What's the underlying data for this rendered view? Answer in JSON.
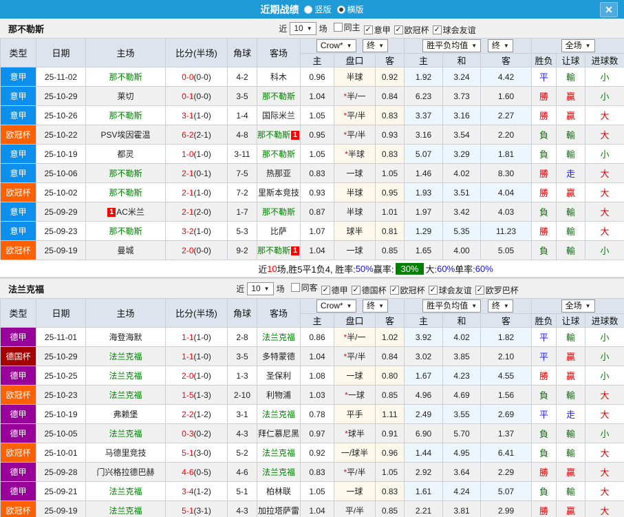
{
  "titlebar": {
    "title": "近期战绩",
    "layout_options": [
      {
        "label": "竖版",
        "selected": false
      },
      {
        "label": "横版",
        "selected": true
      }
    ],
    "close_icon": "✕"
  },
  "ui": {
    "arrow_icon": "▼",
    "check_icon": "✓"
  },
  "headers": {
    "left": [
      "类型",
      "日期",
      "主场",
      "比分(半场)",
      "角球",
      "客场"
    ],
    "sub": [
      "主",
      "盘口",
      "客",
      "主",
      "和",
      "客"
    ],
    "right": [
      "胜负",
      "让球",
      "进球数"
    ],
    "selects": {
      "company": "Crow*",
      "final1": "终",
      "avg": "胜平负均值",
      "final2": "终",
      "scope": "全场"
    }
  },
  "colors": {
    "titlebar_bg": "#1e9ad6",
    "close_bg": "#4dabdf",
    "header_bg": "#dee4ee",
    "filter_bg": "#f0f0f0",
    "row_alt_bg": "#f0f0f0",
    "handicap_bg": "#fdf8ec",
    "avg_bg": "#edf6fc",
    "team_green": "#008000",
    "score_red": "#ff0000",
    "win_red": "#dd0000",
    "lose_green": "#008000",
    "draw_blue": "#2222ee",
    "summary_blue": "#1111ee",
    "summary_green_bg": "#008000",
    "border": "#c9cfd7"
  },
  "comp_colors": {
    "意甲": "#0d8fee",
    "欧冠杯": "#ff6000",
    "德甲": "#990099",
    "德国杯": "#a40000"
  },
  "sections": [
    {
      "team": "那不勒斯",
      "filter": {
        "prefix": "近",
        "count": "10",
        "suffix": "场",
        "checkboxes": [
          {
            "label": "同主",
            "checked": false
          },
          {
            "label": "意甲",
            "checked": true
          },
          {
            "label": "欧冠杯",
            "checked": true
          },
          {
            "label": "球会友谊",
            "checked": true
          }
        ]
      },
      "rows": [
        {
          "comp": "意甲",
          "date": "25-11-02",
          "home": {
            "n": "那不勒斯",
            "g": 1
          },
          "score": "0-0",
          "half": "0-0",
          "corner": "4-2",
          "away": {
            "n": "科木"
          },
          "o": [
            "0.96",
            "半球",
            "0.92"
          ],
          "avg": [
            "1.92",
            "3.24",
            "4.42"
          ],
          "res": [
            "平",
            "輸",
            "小"
          ]
        },
        {
          "comp": "意甲",
          "date": "25-10-29",
          "home": {
            "n": "莱切"
          },
          "score": "0-1",
          "half": "0-0",
          "corner": "3-5",
          "away": {
            "n": "那不勒斯",
            "g": 1
          },
          "o": [
            "1.04",
            "*半/一",
            "0.84"
          ],
          "avg": [
            "6.23",
            "3.73",
            "1.60"
          ],
          "res": [
            "勝",
            "贏",
            "小"
          ]
        },
        {
          "comp": "意甲",
          "date": "25-10-26",
          "home": {
            "n": "那不勒斯",
            "g": 1
          },
          "score": "3-1",
          "half": "1-0",
          "corner": "1-4",
          "away": {
            "n": "国际米兰"
          },
          "o": [
            "1.05",
            "*平/半",
            "0.83"
          ],
          "avg": [
            "3.37",
            "3.16",
            "2.27"
          ],
          "res": [
            "勝",
            "贏",
            "大"
          ]
        },
        {
          "comp": "欧冠杯",
          "date": "25-10-22",
          "home": {
            "n": "PSV埃因霍温"
          },
          "score": "6-2",
          "half": "2-1",
          "corner": "4-8",
          "away": {
            "n": "那不勒斯",
            "g": 1,
            "b": "1",
            "bp": "post"
          },
          "o": [
            "0.95",
            "*平/半",
            "0.93"
          ],
          "avg": [
            "3.16",
            "3.54",
            "2.20"
          ],
          "res": [
            "負",
            "輸",
            "大"
          ]
        },
        {
          "comp": "意甲",
          "date": "25-10-19",
          "home": {
            "n": "都灵"
          },
          "score": "1-0",
          "half": "1-0",
          "corner": "3-11",
          "away": {
            "n": "那不勒斯",
            "g": 1
          },
          "o": [
            "1.05",
            "*半球",
            "0.83"
          ],
          "avg": [
            "5.07",
            "3.29",
            "1.81"
          ],
          "res": [
            "負",
            "輸",
            "小"
          ]
        },
        {
          "comp": "意甲",
          "date": "25-10-06",
          "home": {
            "n": "那不勒斯",
            "g": 1
          },
          "score": "2-1",
          "half": "0-1",
          "corner": "7-5",
          "away": {
            "n": "热那亚"
          },
          "o": [
            "0.83",
            "一球",
            "1.05"
          ],
          "avg": [
            "1.46",
            "4.02",
            "8.30"
          ],
          "res": [
            "勝",
            "走",
            "大"
          ]
        },
        {
          "comp": "欧冠杯",
          "date": "25-10-02",
          "home": {
            "n": "那不勒斯",
            "g": 1
          },
          "score": "2-1",
          "half": "1-0",
          "corner": "7-2",
          "away": {
            "n": "里斯本竞技"
          },
          "o": [
            "0.93",
            "半球",
            "0.95"
          ],
          "avg": [
            "1.93",
            "3.51",
            "4.04"
          ],
          "res": [
            "勝",
            "贏",
            "大"
          ]
        },
        {
          "comp": "意甲",
          "date": "25-09-29",
          "home": {
            "n": "AC米兰",
            "b": "1",
            "bp": "pre"
          },
          "score": "2-1",
          "half": "2-0",
          "corner": "1-7",
          "away": {
            "n": "那不勒斯",
            "g": 1
          },
          "o": [
            "0.87",
            "半球",
            "1.01"
          ],
          "avg": [
            "1.97",
            "3.42",
            "4.03"
          ],
          "res": [
            "負",
            "輸",
            "大"
          ]
        },
        {
          "comp": "意甲",
          "date": "25-09-23",
          "home": {
            "n": "那不勒斯",
            "g": 1
          },
          "score": "3-2",
          "half": "1-0",
          "corner": "5-3",
          "away": {
            "n": "比萨"
          },
          "o": [
            "1.07",
            "球半",
            "0.81"
          ],
          "avg": [
            "1.29",
            "5.35",
            "11.23"
          ],
          "res": [
            "勝",
            "輸",
            "大"
          ]
        },
        {
          "comp": "欧冠杯",
          "date": "25-09-19",
          "home": {
            "n": "曼城"
          },
          "score": "2-0",
          "half": "0-0",
          "corner": "9-2",
          "away": {
            "n": "那不勒斯",
            "g": 1,
            "b": "1",
            "bp": "post"
          },
          "o": [
            "1.04",
            "一球",
            "0.85"
          ],
          "avg": [
            "1.65",
            "4.00",
            "5.05"
          ],
          "res": [
            "負",
            "輸",
            "小"
          ]
        }
      ],
      "summary": [
        {
          "t": "近"
        },
        {
          "t": "10",
          "c": "red"
        },
        {
          "t": "场,胜5平1负4, 胜率:"
        },
        {
          "t": "50%",
          "c": "blue"
        },
        {
          "t": " 赢率: "
        },
        {
          "t": "30%",
          "c": "greenbox"
        },
        {
          "t": " 大:"
        },
        {
          "t": "60%",
          "c": "blue"
        },
        {
          "t": " 单率:"
        },
        {
          "t": "60%",
          "c": "blue"
        }
      ]
    },
    {
      "team": "法兰克福",
      "filter": {
        "prefix": "近",
        "count": "10",
        "suffix": "场",
        "checkboxes": [
          {
            "label": "同客",
            "checked": false
          },
          {
            "label": "德甲",
            "checked": true
          },
          {
            "label": "德国杯",
            "checked": true
          },
          {
            "label": "欧冠杯",
            "checked": true
          },
          {
            "label": "球会友谊",
            "checked": true
          },
          {
            "label": "欧罗巴杯",
            "checked": true
          }
        ]
      },
      "rows": [
        {
          "comp": "德甲",
          "date": "25-11-01",
          "home": {
            "n": "海登海默"
          },
          "score": "1-1",
          "half": "1-0",
          "corner": "2-8",
          "away": {
            "n": "法兰克福",
            "g": 1
          },
          "o": [
            "0.86",
            "*半/一",
            "1.02"
          ],
          "avg": [
            "3.92",
            "4.02",
            "1.82"
          ],
          "res": [
            "平",
            "輸",
            "小"
          ]
        },
        {
          "comp": "德国杯",
          "date": "25-10-29",
          "home": {
            "n": "法兰克福",
            "g": 1
          },
          "score": "1-1",
          "half": "1-0",
          "corner": "3-5",
          "away": {
            "n": "多特蒙德"
          },
          "o": [
            "1.04",
            "*平/半",
            "0.84"
          ],
          "avg": [
            "3.02",
            "3.85",
            "2.10"
          ],
          "res": [
            "平",
            "贏",
            "小"
          ]
        },
        {
          "comp": "德甲",
          "date": "25-10-25",
          "home": {
            "n": "法兰克福",
            "g": 1
          },
          "score": "2-0",
          "half": "1-0",
          "corner": "1-3",
          "away": {
            "n": "圣保利"
          },
          "o": [
            "1.08",
            "一球",
            "0.80"
          ],
          "avg": [
            "1.67",
            "4.23",
            "4.55"
          ],
          "res": [
            "勝",
            "贏",
            "小"
          ]
        },
        {
          "comp": "欧冠杯",
          "date": "25-10-23",
          "home": {
            "n": "法兰克福",
            "g": 1
          },
          "score": "1-5",
          "half": "1-3",
          "corner": "2-10",
          "away": {
            "n": "利物浦"
          },
          "o": [
            "1.03",
            "*一球",
            "0.85"
          ],
          "avg": [
            "4.96",
            "4.69",
            "1.56"
          ],
          "res": [
            "負",
            "輸",
            "大"
          ]
        },
        {
          "comp": "德甲",
          "date": "25-10-19",
          "home": {
            "n": "弗赖堡"
          },
          "score": "2-2",
          "half": "1-2",
          "corner": "3-1",
          "away": {
            "n": "法兰克福",
            "g": 1
          },
          "o": [
            "0.78",
            "平手",
            "1.11"
          ],
          "avg": [
            "2.49",
            "3.55",
            "2.69"
          ],
          "res": [
            "平",
            "走",
            "大"
          ]
        },
        {
          "comp": "德甲",
          "date": "25-10-05",
          "home": {
            "n": "法兰克福",
            "g": 1
          },
          "score": "0-3",
          "half": "0-2",
          "corner": "4-3",
          "away": {
            "n": "拜仁慕尼黑"
          },
          "o": [
            "0.97",
            "*球半",
            "0.91"
          ],
          "avg": [
            "6.90",
            "5.70",
            "1.37"
          ],
          "res": [
            "負",
            "輸",
            "小"
          ]
        },
        {
          "comp": "欧冠杯",
          "date": "25-10-01",
          "home": {
            "n": "马德里竞技"
          },
          "score": "5-1",
          "half": "3-0",
          "corner": "5-2",
          "away": {
            "n": "法兰克福",
            "g": 1
          },
          "o": [
            "0.92",
            "一/球半",
            "0.96"
          ],
          "avg": [
            "1.44",
            "4.95",
            "6.41"
          ],
          "res": [
            "負",
            "輸",
            "大"
          ]
        },
        {
          "comp": "德甲",
          "date": "25-09-28",
          "home": {
            "n": "门兴格拉德巴赫"
          },
          "score": "4-6",
          "half": "0-5",
          "corner": "4-6",
          "away": {
            "n": "法兰克福",
            "g": 1
          },
          "o": [
            "0.83",
            "*平/半",
            "1.05"
          ],
          "avg": [
            "2.92",
            "3.64",
            "2.29"
          ],
          "res": [
            "勝",
            "贏",
            "大"
          ]
        },
        {
          "comp": "德甲",
          "date": "25-09-21",
          "home": {
            "n": "法兰克福",
            "g": 1
          },
          "score": "3-4",
          "half": "1-2",
          "corner": "5-1",
          "away": {
            "n": "柏林联"
          },
          "o": [
            "1.05",
            "一球",
            "0.83"
          ],
          "avg": [
            "1.61",
            "4.24",
            "5.07"
          ],
          "res": [
            "負",
            "輸",
            "大"
          ]
        },
        {
          "comp": "欧冠杯",
          "date": "25-09-19",
          "home": {
            "n": "法兰克福",
            "g": 1
          },
          "score": "5-1",
          "half": "3-1",
          "corner": "4-3",
          "away": {
            "n": "加拉塔萨雷"
          },
          "o": [
            "1.04",
            "平/半",
            "0.85"
          ],
          "avg": [
            "2.21",
            "3.81",
            "2.99"
          ],
          "res": [
            "勝",
            "贏",
            "大"
          ]
        }
      ],
      "summary": null
    }
  ]
}
